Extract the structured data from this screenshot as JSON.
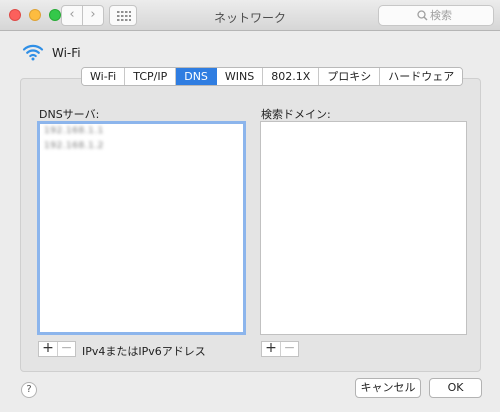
{
  "titlebar": {
    "title": "ネットワーク",
    "search_placeholder": "検索",
    "back_glyph": "‹",
    "forward_glyph": "›"
  },
  "interface": {
    "name": "Wi-Fi"
  },
  "tabs": [
    {
      "label": "Wi-Fi",
      "active": false
    },
    {
      "label": "TCP/IP",
      "active": false
    },
    {
      "label": "DNS",
      "active": true
    },
    {
      "label": "WINS",
      "active": false
    },
    {
      "label": "802.1X",
      "active": false
    },
    {
      "label": "プロキシ",
      "active": false
    },
    {
      "label": "ハードウェア",
      "active": false
    }
  ],
  "dns_servers": {
    "label": "DNSサーバ:",
    "entries": [
      "192.168.1.1",
      "192.168.1.2"
    ],
    "hint": "IPv4またはIPv6アドレス"
  },
  "search_domains": {
    "label": "検索ドメイン:"
  },
  "controls": {
    "add": "+",
    "remove": "−",
    "help": "?"
  },
  "buttons": {
    "cancel": "キャンセル",
    "ok": "OK"
  },
  "colors": {
    "accent": "#2f7de1",
    "focus_ring": "#8cb5ec"
  }
}
